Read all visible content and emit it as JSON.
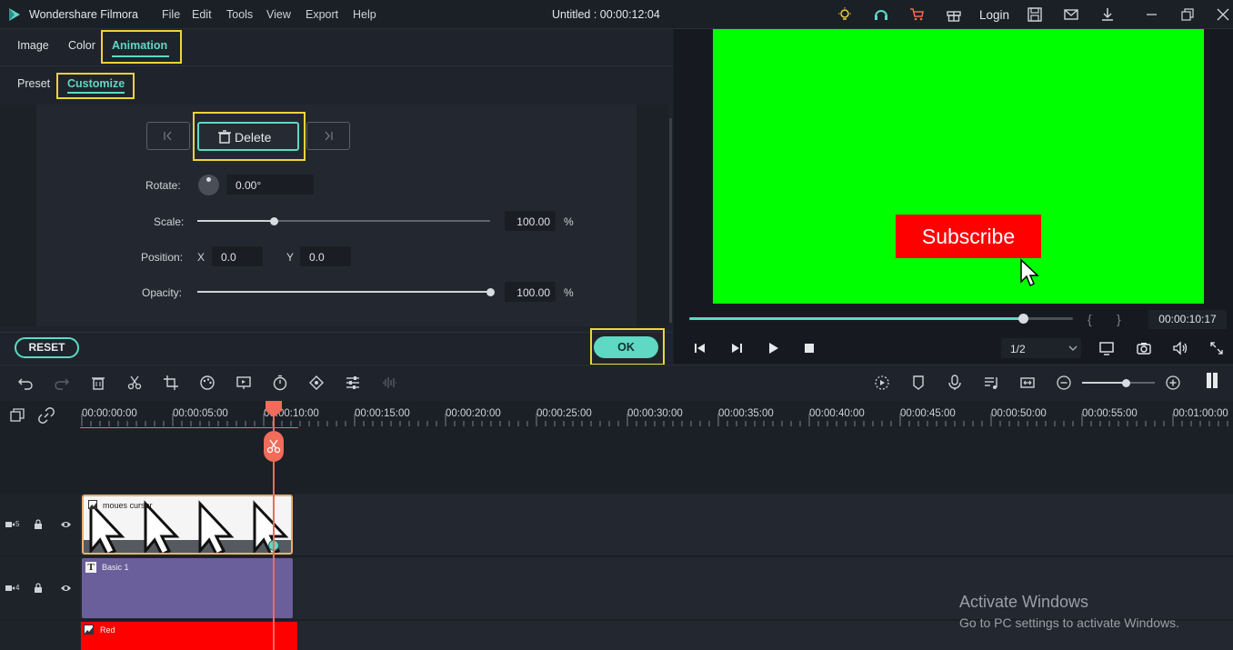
{
  "app": {
    "name": "Wondershare Filmora",
    "menu": [
      "File",
      "Edit",
      "Tools",
      "View",
      "Export",
      "Help"
    ],
    "title": "Untitled : 00:00:12:04",
    "login": "Login"
  },
  "tabs": {
    "image": "Image",
    "color": "Color",
    "animation": "Animation"
  },
  "subtabs": {
    "preset": "Preset",
    "customize": "Customize"
  },
  "keyframe": {
    "delete_label": "Delete"
  },
  "props": {
    "rotate_label": "Rotate:",
    "rotate_value": "0.00°",
    "scale_label": "Scale:",
    "scale_value": "100.00",
    "scale_unit": "%",
    "position_label": "Position:",
    "x_label": "X",
    "x_value": "0.0",
    "y_label": "Y",
    "y_value": "0.0",
    "opacity_label": "Opacity:",
    "opacity_value": "100.00",
    "opacity_unit": "%",
    "scale_fraction": 0.26,
    "opacity_fraction": 1.0
  },
  "buttons": {
    "reset": "RESET",
    "ok": "OK"
  },
  "preview": {
    "subscribe_text": "Subscribe",
    "timecode": "00:00:10:17",
    "quality": "1/2",
    "brace_open": "{",
    "brace_close": "}",
    "progress_fraction": 0.87
  },
  "ruler_ticks": [
    "00:00:00:00",
    "00:00:05:00",
    "00:00:10:00",
    "00:00:15:00",
    "00:00:20:00",
    "00:00:25:00",
    "00:00:30:00",
    "00:00:35:00",
    "00:00:40:00",
    "00:00:45:00",
    "00:00:50:00",
    "00:00:55:00",
    "00:01:00:00"
  ],
  "tracks": {
    "t5_num": "5",
    "t4_num": "4",
    "clip_cursor": "moues cursor",
    "clip_basic": "Basic 1",
    "clip_red": "Red"
  },
  "watermark": {
    "line1": "Activate Windows",
    "line2": "Go to PC settings to activate Windows."
  },
  "colors": {
    "accent": "#5fd8c4",
    "highlight": "#f0d33c",
    "playhead": "#f26b5b",
    "green_screen": "#00ff00",
    "red": "#ff0000",
    "title_clip": "#6a5f9a"
  }
}
